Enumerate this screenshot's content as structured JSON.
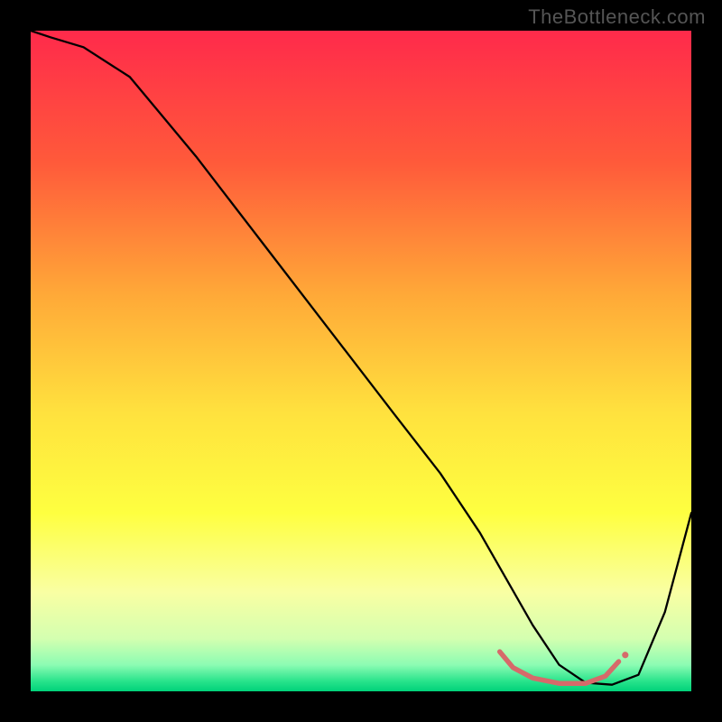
{
  "watermark": "TheBottleneck.com",
  "chart_data": {
    "type": "line",
    "title": "",
    "xlabel": "",
    "ylabel": "",
    "xlim": [
      0,
      100
    ],
    "ylim": [
      0,
      100
    ],
    "gradient_stops": [
      {
        "offset": 0.0,
        "color": "#ff2a4b"
      },
      {
        "offset": 0.2,
        "color": "#ff5a3a"
      },
      {
        "offset": 0.4,
        "color": "#ffa938"
      },
      {
        "offset": 0.58,
        "color": "#ffe23e"
      },
      {
        "offset": 0.73,
        "color": "#feff40"
      },
      {
        "offset": 0.85,
        "color": "#f9ffa3"
      },
      {
        "offset": 0.92,
        "color": "#d4ffb0"
      },
      {
        "offset": 0.96,
        "color": "#8cfcb3"
      },
      {
        "offset": 0.985,
        "color": "#27e38b"
      },
      {
        "offset": 1.0,
        "color": "#00d27a"
      }
    ],
    "series": [
      {
        "name": "curve",
        "stroke": "#000000",
        "stroke_width": 2.3,
        "x": [
          0,
          3,
          8,
          15,
          25,
          35,
          45,
          55,
          62,
          68,
          72,
          76,
          80,
          84,
          88,
          92,
          96,
          100
        ],
        "values": [
          100,
          99,
          97.5,
          93,
          81,
          68,
          55,
          42,
          33,
          24,
          17,
          10,
          4,
          1.3,
          1.0,
          2.5,
          12,
          27
        ]
      },
      {
        "name": "highlight-flat",
        "stroke": "#d66a6a",
        "stroke_width": 5.5,
        "x": [
          71,
          73,
          76,
          80,
          84,
          87,
          89
        ],
        "values": [
          6.0,
          3.6,
          2.0,
          1.2,
          1.2,
          2.3,
          4.5
        ]
      }
    ],
    "markers": [
      {
        "name": "highlight-dot",
        "x": 90,
        "y": 5.5,
        "r": 3.6,
        "fill": "#d66a6a"
      }
    ]
  }
}
